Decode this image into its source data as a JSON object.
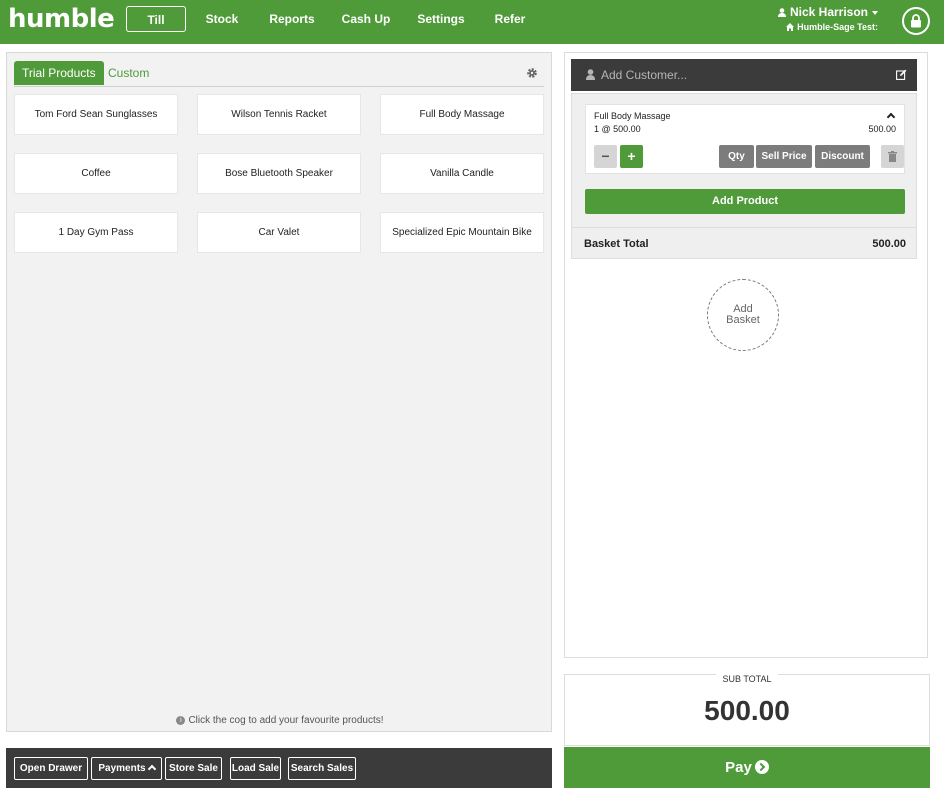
{
  "app": {
    "logo": "humble"
  },
  "nav": {
    "items": [
      {
        "label": "Till",
        "active": true
      },
      {
        "label": "Stock"
      },
      {
        "label": "Reports"
      },
      {
        "label": "Cash Up"
      },
      {
        "label": "Settings"
      },
      {
        "label": "Refer"
      }
    ]
  },
  "user": {
    "name": "Nick Harrison",
    "store": "Humble-Sage Test:"
  },
  "products": {
    "tabs": [
      {
        "label": "Trial Products",
        "active": true
      },
      {
        "label": "Custom"
      }
    ],
    "items": [
      "Tom Ford Sean Sunglasses",
      "Wilson Tennis Racket",
      "Full Body Massage",
      "Coffee",
      "Bose Bluetooth Speaker",
      "Vanilla Candle",
      "1 Day Gym Pass",
      "Car Valet",
      "Specialized Epic Mountain Bike"
    ],
    "hint": "Click the cog to add your favourite products!"
  },
  "toolbar": {
    "open_drawer": "Open Drawer",
    "payments": "Payments",
    "store_sale": "Store Sale",
    "load_sale": "Load Sale",
    "search_sales": "Search Sales"
  },
  "customer": {
    "placeholder": "Add Customer..."
  },
  "basket": {
    "line": {
      "name": "Full Body Massage",
      "qty_price": "1 @ 500.00",
      "total": "500.00"
    },
    "buttons": {
      "qty": "Qty",
      "sell_price": "Sell Price",
      "discount": "Discount",
      "minus": "−",
      "plus": "+"
    },
    "add_product": "Add Product",
    "total_label": "Basket Total",
    "total_value": "500.00",
    "add_basket_line1": "Add",
    "add_basket_line2": "Basket"
  },
  "summary": {
    "subtotal_label": "SUB TOTAL",
    "subtotal_value": "500.00",
    "pay_label": "Pay"
  },
  "colors": {
    "brand": "#4f9a39",
    "dark": "#3b3b3b",
    "grey_button": "#7c7c7c"
  }
}
